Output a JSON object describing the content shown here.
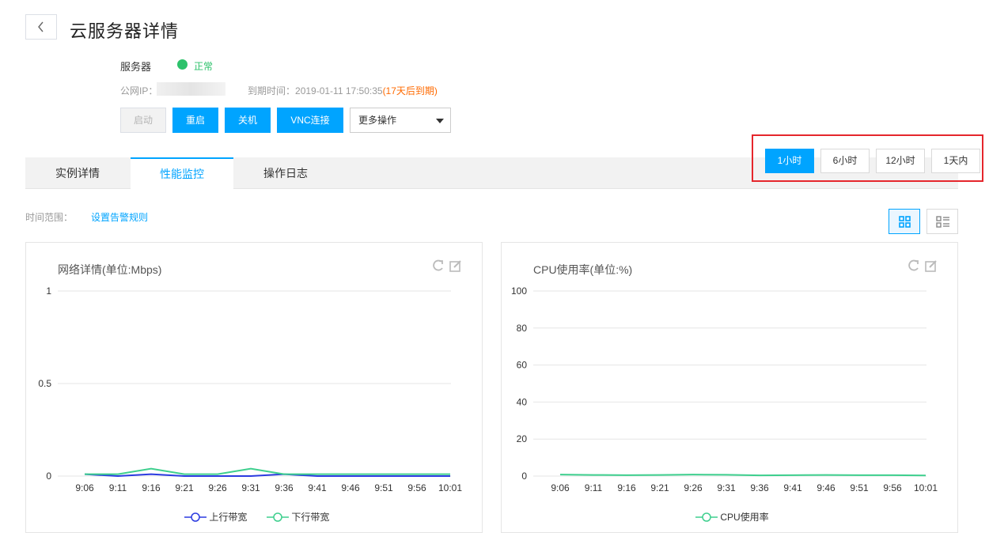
{
  "header": {
    "title": "云服务器详情"
  },
  "server": {
    "label": "服务器",
    "status": "正常",
    "ip_label": "公网IP：",
    "expire_label": "到期时间：",
    "expire_time": "2019-01-11 17:50:35",
    "expire_note": "(17天后到期)"
  },
  "actions": {
    "start": "启动",
    "restart": "重启",
    "shutdown": "关机",
    "vnc": "VNC连接",
    "more": "更多操作"
  },
  "tabs": [
    {
      "label": "实例详情"
    },
    {
      "label": "性能监控"
    },
    {
      "label": "操作日志"
    }
  ],
  "time_range": {
    "label": "时间范围：",
    "alarm_link": "设置告警规则",
    "options": [
      "1小时",
      "6小时",
      "12小时",
      "1天内"
    ],
    "selected": "1小时"
  },
  "colors": {
    "primary": "#00a4ff",
    "status_ok": "#2dc26b",
    "warn": "#ff6a00",
    "highlight": "#e5262c",
    "series_up": "#2b3be0",
    "series_down": "#3ecf8e"
  },
  "chart_data": [
    {
      "type": "line",
      "title": "网络详情(单位:Mbps)",
      "x": [
        "9:06",
        "9:11",
        "9:16",
        "9:21",
        "9:26",
        "9:31",
        "9:36",
        "9:41",
        "9:46",
        "9:51",
        "9:56",
        "10:01"
      ],
      "yticks": [
        "1",
        "0.5",
        "0"
      ],
      "ylim": [
        0,
        1
      ],
      "series": [
        {
          "name": "上行带宽",
          "values": [
            0.01,
            0.0,
            0.01,
            0.0,
            0.0,
            0.0,
            0.01,
            0.0,
            0.0,
            0.0,
            0.0,
            0.0
          ]
        },
        {
          "name": "下行带宽",
          "values": [
            0.01,
            0.01,
            0.04,
            0.01,
            0.01,
            0.04,
            0.01,
            0.01,
            0.01,
            0.01,
            0.01,
            0.01
          ]
        }
      ]
    },
    {
      "type": "line",
      "title": "CPU使用率(单位:%)",
      "x": [
        "9:06",
        "9:11",
        "9:16",
        "9:21",
        "9:26",
        "9:31",
        "9:36",
        "9:41",
        "9:46",
        "9:51",
        "9:56",
        "10:01"
      ],
      "yticks": [
        "100",
        "80",
        "60",
        "40",
        "20",
        "0"
      ],
      "ylim": [
        0,
        100
      ],
      "series": [
        {
          "name": "CPU使用率",
          "values": [
            0.8,
            0.6,
            0.5,
            0.6,
            0.8,
            0.7,
            0.4,
            0.5,
            0.6,
            0.5,
            0.5,
            0.3
          ]
        }
      ]
    }
  ]
}
